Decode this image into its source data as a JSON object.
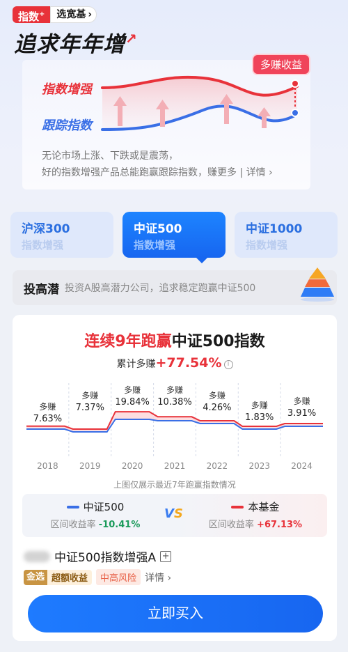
{
  "header": {
    "brand": "指数",
    "brand_sup": "+",
    "pick_label": "选宽基",
    "pick_chevron": "›",
    "title": "追求年年增"
  },
  "hero": {
    "line_top_label": "指数增强",
    "line_bottom_label": "跟踪指数",
    "tip": "多赚收益",
    "desc_line1": "无论市场上涨、下跌或是震荡，",
    "desc_line2": "好的指数增强产品总能跑赢跟踪指数，赚更多",
    "desc_more": "详情 ›",
    "colors": {
      "top_line": "#e8323a",
      "bottom_line": "#3a6fe6"
    }
  },
  "tabs": [
    {
      "name": "沪深300",
      "sub": "指数增强",
      "active": false
    },
    {
      "name": "中证500",
      "sub": "指数增强",
      "active": true
    },
    {
      "name": "中证1000",
      "sub": "指数增强",
      "active": false
    }
  ],
  "strategy": {
    "key": "投高潜",
    "value": "投资A股高潜力公司，追求稳定跑赢中证500"
  },
  "card": {
    "title_red": "连续9年跑赢",
    "title_black": "中证500指数",
    "cum_label": "累计多赚",
    "cum_value": "+77.54%",
    "cum_info": "i",
    "note": "上图仅展示最近7年跑赢指数情况",
    "compare": {
      "left_name": "中证500",
      "left_label": "区间收益率",
      "left_value": "-10.41%",
      "right_name": "本基金",
      "right_label": "区间收益率",
      "right_value": "+67.13%",
      "vs": "VS",
      "left_color": "#3a6fe6",
      "right_color": "#e8323a"
    },
    "fund_name": "中证500指数增强A",
    "fund_plus": "+",
    "tag_gold_1": "金选",
    "tag_gold_2": "超额收益",
    "tag_risk": "中高风险",
    "tag_detail": "详情 ›",
    "buy_label": "立即买入"
  },
  "chart_data": {
    "type": "area",
    "categories": [
      "2018",
      "2019",
      "2020",
      "2021",
      "2022",
      "2023",
      "2024"
    ],
    "label_prefix": "多赚",
    "labels": [
      "7.63%",
      "7.37%",
      "19.84%",
      "10.38%",
      "4.26%",
      "1.83%",
      "3.91%"
    ],
    "excess": [
      7.63,
      7.37,
      19.84,
      10.38,
      4.26,
      1.83,
      3.91
    ],
    "series": [
      {
        "name": "本基金",
        "color": "#e8323a"
      },
      {
        "name": "中证500",
        "color": "#3a6fe6"
      }
    ]
  }
}
